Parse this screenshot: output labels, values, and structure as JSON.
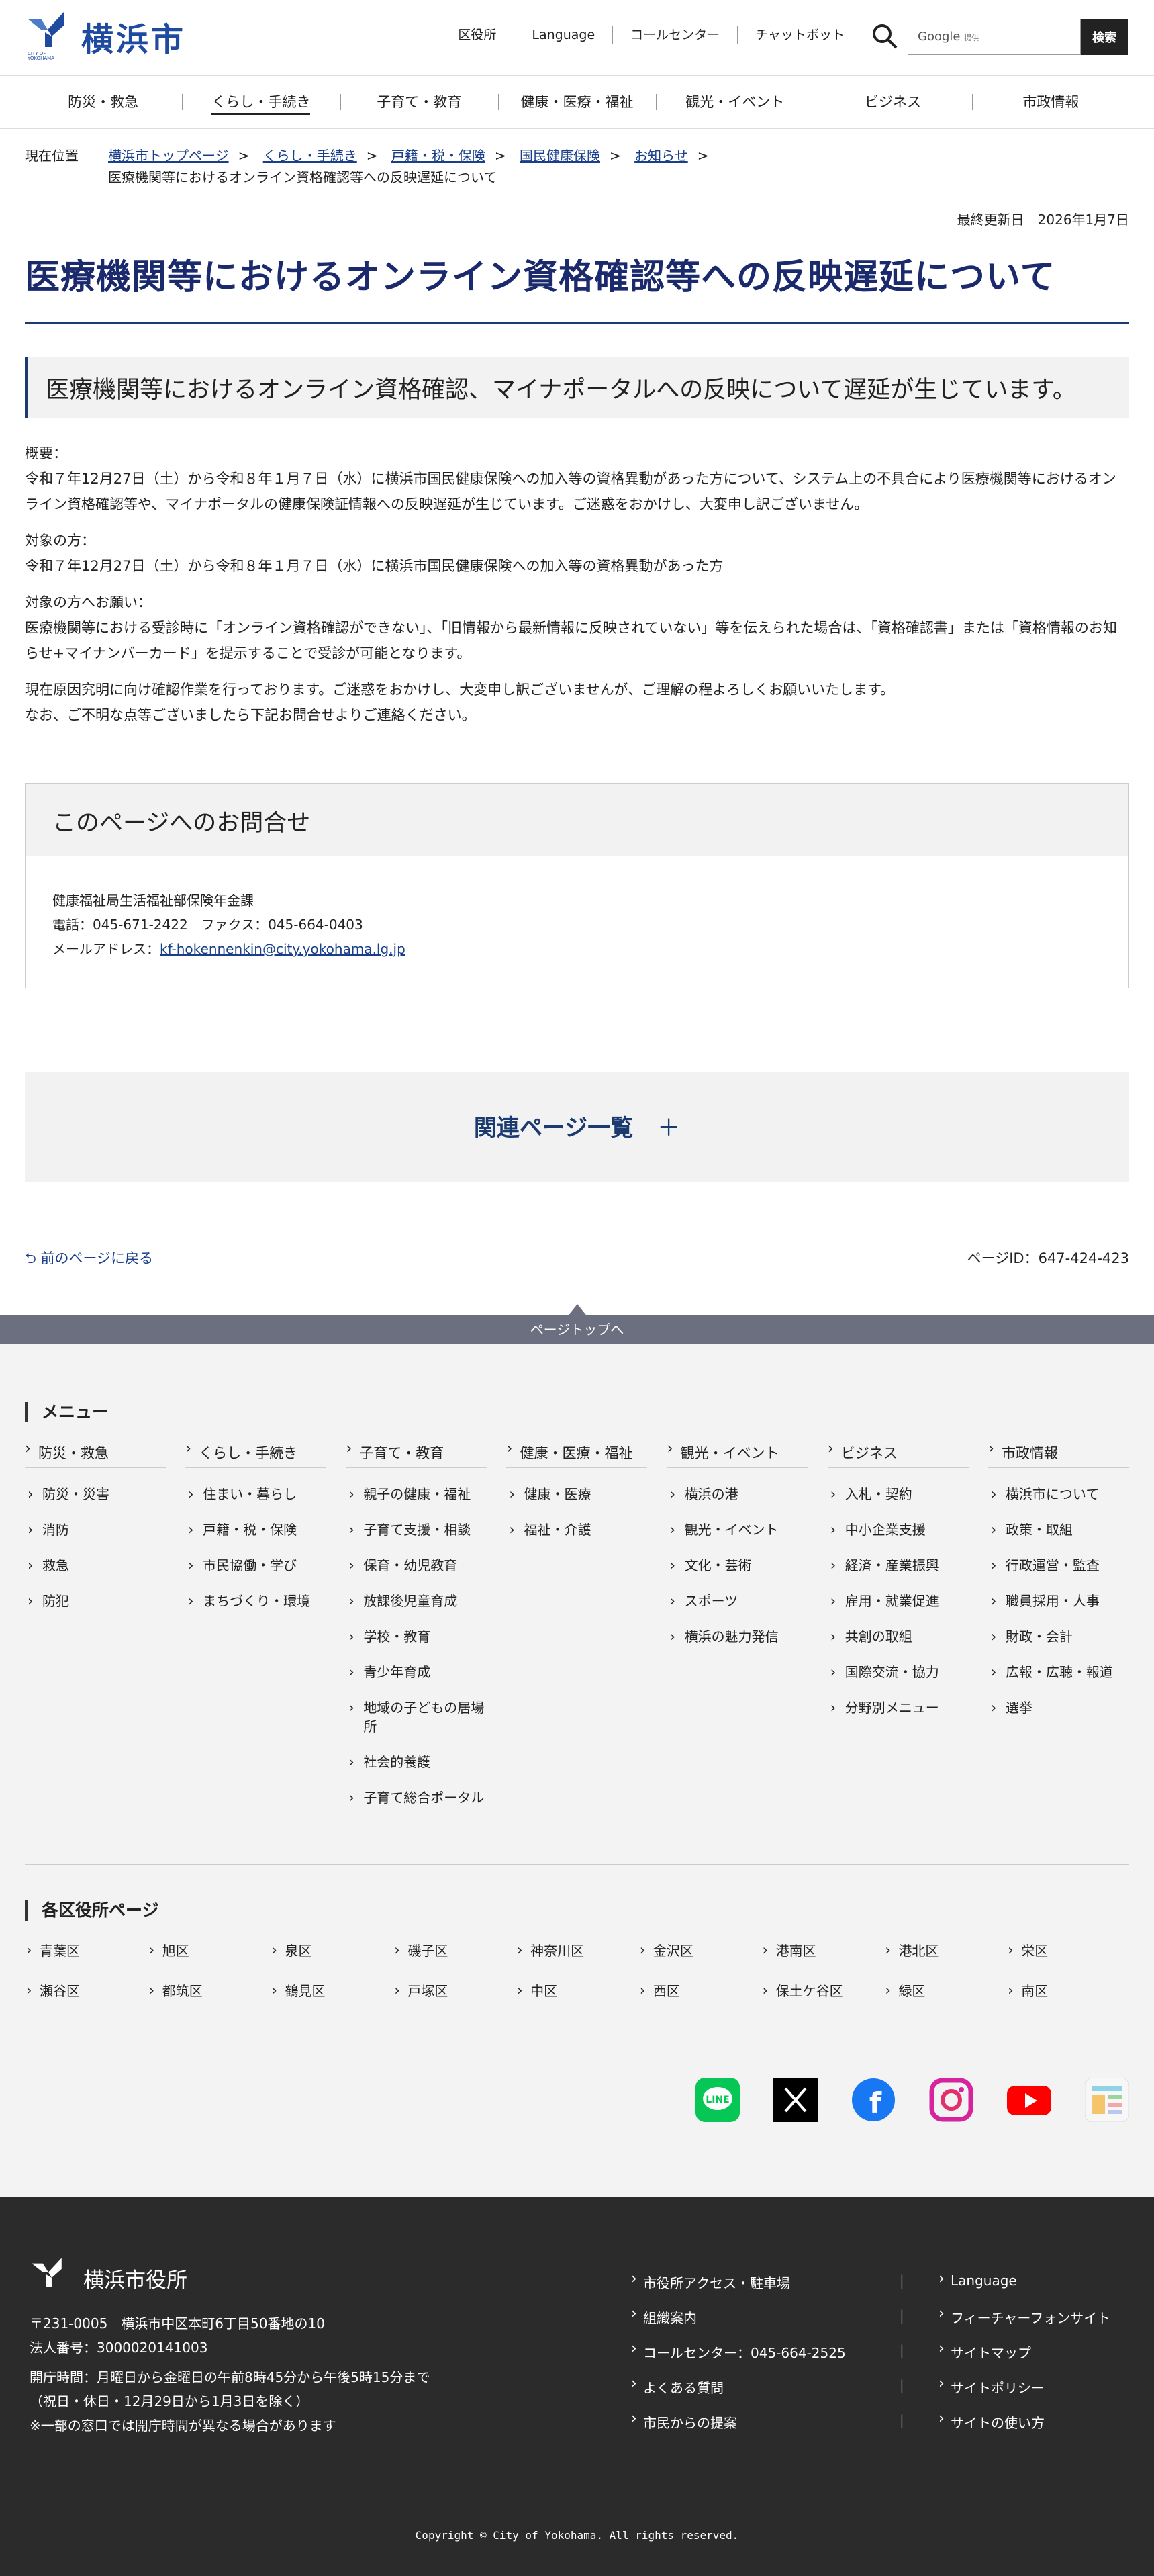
{
  "header": {
    "logo_text": "横浜市",
    "logo_sub": "CITY OF YOKOHAMA",
    "topnav": [
      "区役所",
      "Language",
      "コールセンター",
      "チャットボット"
    ],
    "search_google": "Google",
    "search_provided": "提供",
    "search_button": "検索"
  },
  "gnav": [
    "防災・救急",
    "くらし・手続き",
    "子育て・教育",
    "健康・医療・福祉",
    "観光・イベント",
    "ビジネス",
    "市政情報"
  ],
  "breadcrumb": {
    "label": "現在位置",
    "items": [
      "横浜市トップページ",
      "くらし・手続き",
      "戸籍・税・保険",
      "国民健康保険",
      "お知らせ"
    ],
    "current": "医療機関等におけるオンライン資格確認等への反映遅延について"
  },
  "updated": "最終更新日　2026年1月7日",
  "title": "医療機関等におけるオンライン資格確認等への反映遅延について",
  "lead": "医療機関等におけるオンライン資格確認、マイナポータルへの反映について遅延が生じています。",
  "body": {
    "p1_head": "概要：",
    "p1": "令和７年12月27日（土）から令和８年１月７日（水）に横浜市国民健康保険への加入等の資格異動があった方について、システム上の不具合により医療機関等におけるオンライン資格確認等や、マイナポータルの健康保険証情報への反映遅延が生じています。ご迷惑をおかけし、大変申し訳ございません。",
    "p2_head": "対象の方：",
    "p2": "令和７年12月27日（土）から令和８年１月７日（水）に横浜市国民健康保険への加入等の資格異動があった方",
    "p3_head": "対象の方へお願い：",
    "p3": "医療機関等における受診時に「オンライン資格確認ができない」、「旧情報から最新情報に反映されていない」等を伝えられた場合は、「資格確認書」または「資格情報のお知らせ+マイナンバーカード」を提示することで受診が可能となります。",
    "p4a": "現在原因究明に向け確認作業を行っております。ご迷惑をおかけし、大変申し訳ございませんが、ご理解の程よろしくお願いいたします。",
    "p4b": "なお、ご不明な点等ございましたら下記お問合せよりご連絡ください。"
  },
  "contact": {
    "heading": "このページへのお問合せ",
    "dept": "健康福祉局生活福祉部保険年金課",
    "tel": "電話：045-671-2422　ファクス：045-664-0403",
    "mail_label": "メールアドレス：",
    "mail": "kf-hokennenkin@city.yokohama.lg.jp"
  },
  "related": "関連ページ一覧",
  "back": "前のページに戻る",
  "page_id": "ページID：647-424-423",
  "pagetop": "ページトップへ",
  "footer_menu": {
    "title": "メニュー",
    "cols": [
      {
        "head": "防災・救急",
        "items": [
          "防災・災害",
          "消防",
          "救急",
          "防犯"
        ]
      },
      {
        "head": "くらし・手続き",
        "items": [
          "住まい・暮らし",
          "戸籍・税・保険",
          "市民協働・学び",
          "まちづくり・環境"
        ]
      },
      {
        "head": "子育て・教育",
        "items": [
          "親子の健康・福祉",
          "子育て支援・相談",
          "保育・幼児教育",
          "放課後児童育成",
          "学校・教育",
          "青少年育成",
          "地域の子どもの居場所",
          "社会的養護",
          "子育て総合ポータル"
        ]
      },
      {
        "head": "健康・医療・福祉",
        "items": [
          "健康・医療",
          "福祉・介護"
        ]
      },
      {
        "head": "観光・イベント",
        "items": [
          "横浜の港",
          "観光・イベント",
          "文化・芸術",
          "スポーツ",
          "横浜の魅力発信"
        ]
      },
      {
        "head": "ビジネス",
        "items": [
          "入札・契約",
          "中小企業支援",
          "経済・産業振興",
          "雇用・就業促進",
          "共創の取組",
          "国際交流・協力",
          "分野別メニュー"
        ]
      },
      {
        "head": "市政情報",
        "items": [
          "横浜市について",
          "政策・取組",
          "行政運営・監査",
          "職員採用・人事",
          "財政・会計",
          "広報・広聴・報道",
          "選挙"
        ]
      }
    ],
    "wards_title": "各区役所ページ",
    "wards": [
      "青葉区",
      "旭区",
      "泉区",
      "磯子区",
      "神奈川区",
      "金沢区",
      "港南区",
      "港北区",
      "栄区",
      "瀬谷区",
      "都筑区",
      "鶴見区",
      "戸塚区",
      "中区",
      "西区",
      "保土ケ谷区",
      "緑区",
      "南区"
    ]
  },
  "footer": {
    "name": "横浜市役所",
    "address": "〒231-0005　横浜市中区本町6丁目50番地の10",
    "corp_no": "法人番号：3000020141003",
    "hours1": "開庁時間：月曜日から金曜日の午前8時45分から午後5時15分まで",
    "hours2": "（祝日・休日・12月29日から1月3日を除く）",
    "hours3": "※一部の窓口では開庁時間が異なる場合があります",
    "links": [
      "市役所アクセス・駐車場",
      "組織案内",
      "コールセンター：045-664-2525",
      "よくある質問",
      "市民からの提案"
    ],
    "links2": [
      "Language",
      "フィーチャーフォンサイト",
      "サイトマップ",
      "サイトポリシー",
      "サイトの使い方"
    ],
    "copyright": "Copyright © City of Yokohama. All rights reserved."
  },
  "colors": {
    "brand": "#1e4aa0",
    "title": "#1a2a6c",
    "link": "#1a3f8a",
    "footer": "#2b2b2b"
  }
}
